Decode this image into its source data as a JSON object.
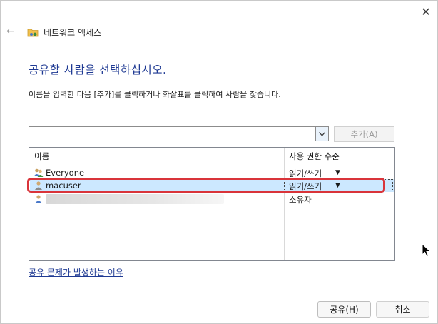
{
  "window": {
    "title": "네트워크 액세스",
    "close_glyph": "✕",
    "back_glyph": "←"
  },
  "heading": "공유할 사람을 선택하십시오.",
  "instruction": "이름을 입력한 다음 [추가]를 클릭하거나 화살표를 클릭하여 사람을 찾습니다.",
  "combo": {
    "value": "",
    "dropdown_icon": "chevron-down-icon"
  },
  "add_button": "추가(A)",
  "list": {
    "columns": {
      "name": "이름",
      "permission": "사용 권한 수준"
    },
    "rows": [
      {
        "name": "Everyone",
        "permission": "읽기/쓰기",
        "has_dropdown": true,
        "icon": "group-icon"
      },
      {
        "name": "macuser",
        "permission": "읽기/쓰기",
        "has_dropdown": true,
        "icon": "user-icon",
        "selected": true
      },
      {
        "name": "",
        "permission": "소유자",
        "has_dropdown": false,
        "icon": "user-icon",
        "redacted": true
      }
    ]
  },
  "dropdown_glyph": "▼",
  "help_link": "공유 문제가 발생하는 이유",
  "buttons": {
    "share": "공유(H)",
    "cancel": "취소"
  },
  "colors": {
    "heading": "#1f3a93",
    "selection": "#cce8ff",
    "highlight": "#d9343a"
  }
}
